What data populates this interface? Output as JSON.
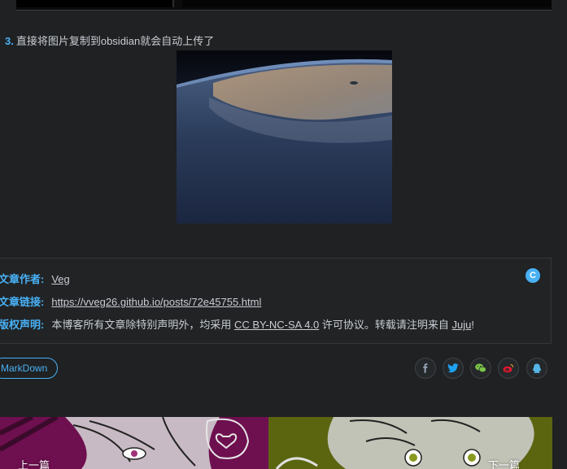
{
  "step": {
    "number": "3.",
    "text": "直接将图片复制到obsidian就会自动上传了"
  },
  "copyright": {
    "author_key": "文章作者:",
    "author_val": "Veg",
    "link_key": "文章链接:",
    "link_val": "https://vveg26.github.io/posts/72e45755.html",
    "license_key": "版权声明:",
    "license_pre": "本博客所有文章除特别声明外，均采用",
    "license_link": "CC BY-NC-SA 4.0",
    "license_mid": "许可协议。转载请注明来自",
    "license_site": "Juju",
    "license_end": "!",
    "badge": "C"
  },
  "tag": {
    "label": "MarkDown"
  },
  "share": [
    "facebook-icon",
    "twitter-icon",
    "wechat-icon",
    "weibo-icon",
    "qq-icon"
  ],
  "pager": {
    "prev_label": "上一篇",
    "next_label": "下一篇"
  },
  "colors": {
    "accent": "#49b1f5",
    "background": "#1f2123",
    "text": "#c9cdd2",
    "facebook": "#3b5998",
    "twitter": "#1da1f2",
    "wechat": "#7bc549",
    "weibo": "#e6162d",
    "qq": "#56b6e7"
  }
}
